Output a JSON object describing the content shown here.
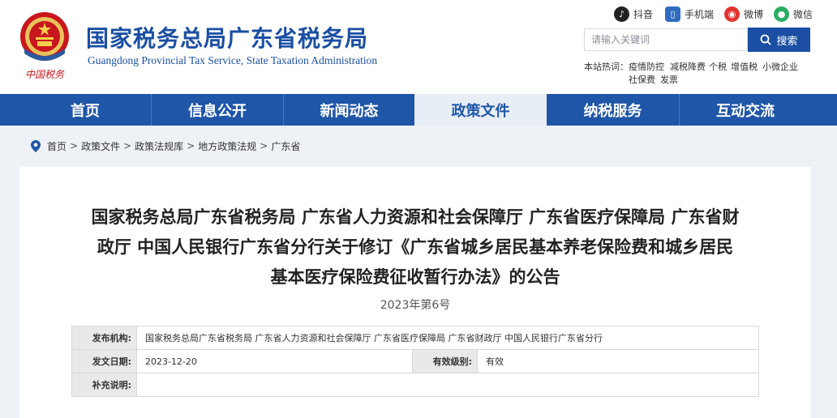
{
  "header": {
    "site_name_cn": "国家税务总局广东省税务局",
    "site_name_en": "Guangdong Provincial Tax Service, State Taxation Administration",
    "logo_caption": "中国税务",
    "social": [
      {
        "label": "抖音",
        "icon": "douyin-icon",
        "color": "#222222"
      },
      {
        "label": "手机端",
        "icon": "mobile-icon",
        "color": "#2f6cc0"
      },
      {
        "label": "微博",
        "icon": "weibo-icon",
        "color": "#e5322d"
      },
      {
        "label": "微信",
        "icon": "wechat-icon",
        "color": "#2aae67"
      }
    ],
    "search": {
      "placeholder": "请输入关键词",
      "button_label": "搜索"
    },
    "hot_label": "本站热词：",
    "hot_keywords": [
      "疫情防控",
      "减税降费",
      "个税",
      "增值税",
      "小微企业",
      "社保费",
      "发票"
    ]
  },
  "nav": {
    "items": [
      "首页",
      "信息公开",
      "新闻动态",
      "政策文件",
      "纳税服务",
      "互动交流"
    ],
    "active_index": 3
  },
  "breadcrumb": [
    "首页",
    "政策文件",
    "政策法规库",
    "地方政策法规",
    "广东省"
  ],
  "article": {
    "title_lines": [
      "国家税务总局广东省税务局 广东省人力资源和社会保障厅 广东省医疗保障局 广东省财",
      "政厅 中国人民银行广东省分行关于修订《广东省城乡居民基本养老保险费和城乡居民",
      "基本医疗保险费征收暂行办法》的公告"
    ],
    "doc_number": "2023年第6号",
    "info": {
      "issuer_label": "发布机构:",
      "issuer": "国家税务总局广东省税务局 广东省人力资源和社会保障厅 广东省医疗保障局 广东省财政厅 中国人民银行广东省分行",
      "date_label": "发文日期:",
      "date": "2023-12-20",
      "validity_label": "有效级别:",
      "validity": "有效",
      "note_label": "补充说明:",
      "note": ""
    }
  },
  "colors": {
    "brand_blue": "#1f56a8",
    "nav_active_bg": "#e8eef6",
    "logo_red": "#c8161d"
  }
}
